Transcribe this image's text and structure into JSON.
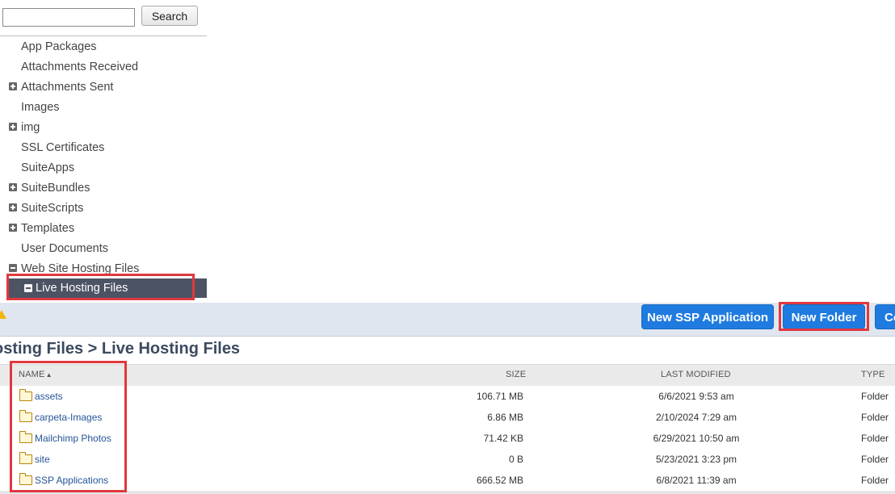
{
  "search": {
    "placeholder": "",
    "value": "",
    "button_label": "Search"
  },
  "tree": {
    "items": [
      {
        "label": "App Packages",
        "expander": "none"
      },
      {
        "label": "Attachments Received",
        "expander": "none"
      },
      {
        "label": "Attachments Sent",
        "expander": "plus"
      },
      {
        "label": "Images",
        "expander": "none"
      },
      {
        "label": "img",
        "expander": "plus"
      },
      {
        "label": "SSL Certificates",
        "expander": "none"
      },
      {
        "label": "SuiteApps",
        "expander": "none"
      },
      {
        "label": "SuiteBundles",
        "expander": "plus"
      },
      {
        "label": "SuiteScripts",
        "expander": "plus"
      },
      {
        "label": "Templates",
        "expander": "plus"
      },
      {
        "label": "User Documents",
        "expander": "none"
      },
      {
        "label": "Web Site Hosting Files",
        "expander": "minus"
      }
    ],
    "selected": {
      "label": "Live Hosting Files",
      "expander": "minus"
    }
  },
  "toolbar": {
    "warning_icon": "warning-icon",
    "new_ssp_label": "New SSP Application",
    "new_folder_label": "New Folder",
    "more_label": "Co"
  },
  "breadcrumb_title": "osting Files > Live Hosting Files",
  "table": {
    "headers": {
      "name": "NAME",
      "sort_indicator": "▲",
      "size": "SIZE",
      "last_modified": "LAST MODIFIED",
      "type": "TYPE"
    },
    "rows": [
      {
        "name": "assets",
        "size": "106.71 MB",
        "last_modified": "6/6/2021 9:53 am",
        "type": "Folder"
      },
      {
        "name": "carpeta-Images",
        "size": "6.86 MB",
        "last_modified": "2/10/2024 7:29 am",
        "type": "Folder"
      },
      {
        "name": "Mailchimp Photos",
        "size": "71.42 KB",
        "last_modified": "6/29/2021 10:50 am",
        "type": "Folder"
      },
      {
        "name": "site",
        "size": "0 B",
        "last_modified": "5/23/2021 3:23 pm",
        "type": "Folder"
      },
      {
        "name": "SSP Applications",
        "size": "666.52 MB",
        "last_modified": "6/8/2021 11:39 am",
        "type": "Folder"
      }
    ]
  },
  "colors": {
    "highlight": "#e0383e",
    "button": "#1f7be0",
    "selected_row": "#4c5464",
    "link": "#255599"
  }
}
